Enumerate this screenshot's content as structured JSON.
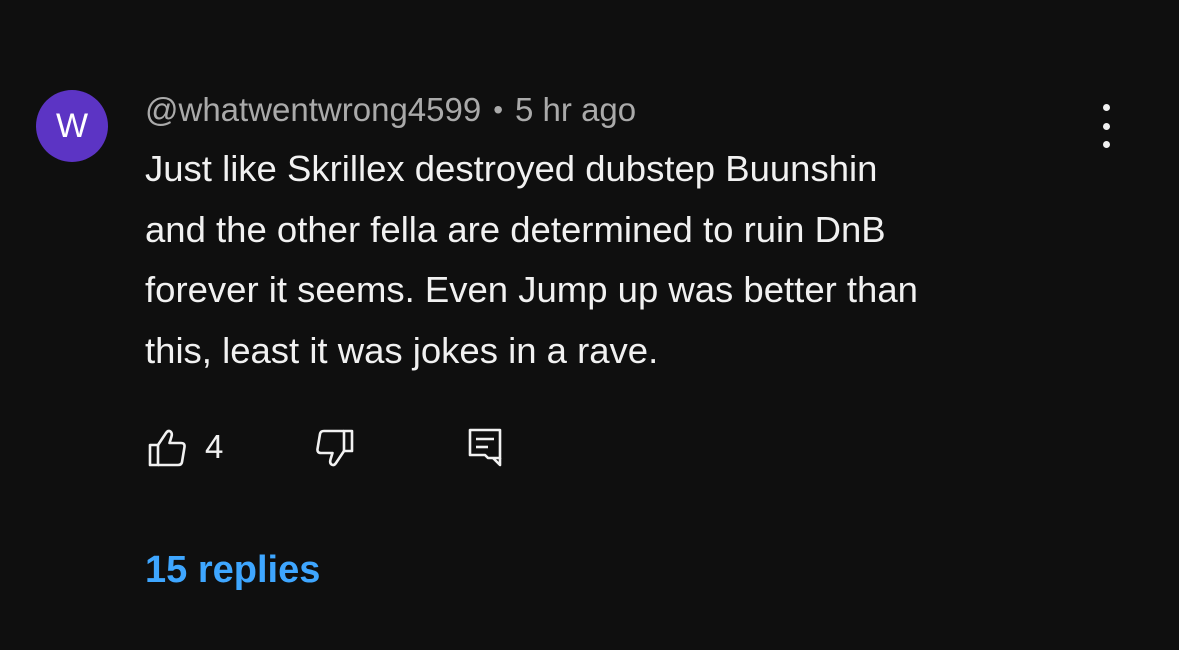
{
  "comment": {
    "avatar_letter": "W",
    "avatar_color": "#5c34c4",
    "author": "@whatwentwrong4599",
    "separator": "•",
    "time": "5 hr ago",
    "text_lines": [
      "Just like Skrillex destroyed dubstep Buunshin",
      "and the other fella are determined to ruin DnB",
      "forever it seems. Even Jump up was better than",
      "this, least it was jokes in a rave."
    ],
    "like_count": "4",
    "replies_label": "15 replies",
    "icons": {
      "like": "thumb-up-icon",
      "dislike": "thumb-down-icon",
      "reply": "reply-comment-icon",
      "menu": "more-vert-icon"
    },
    "colors": {
      "background": "#0f0f0f",
      "text": "#f1f1f1",
      "secondary_text": "#aaaaaa",
      "link": "#3ea6ff"
    }
  }
}
